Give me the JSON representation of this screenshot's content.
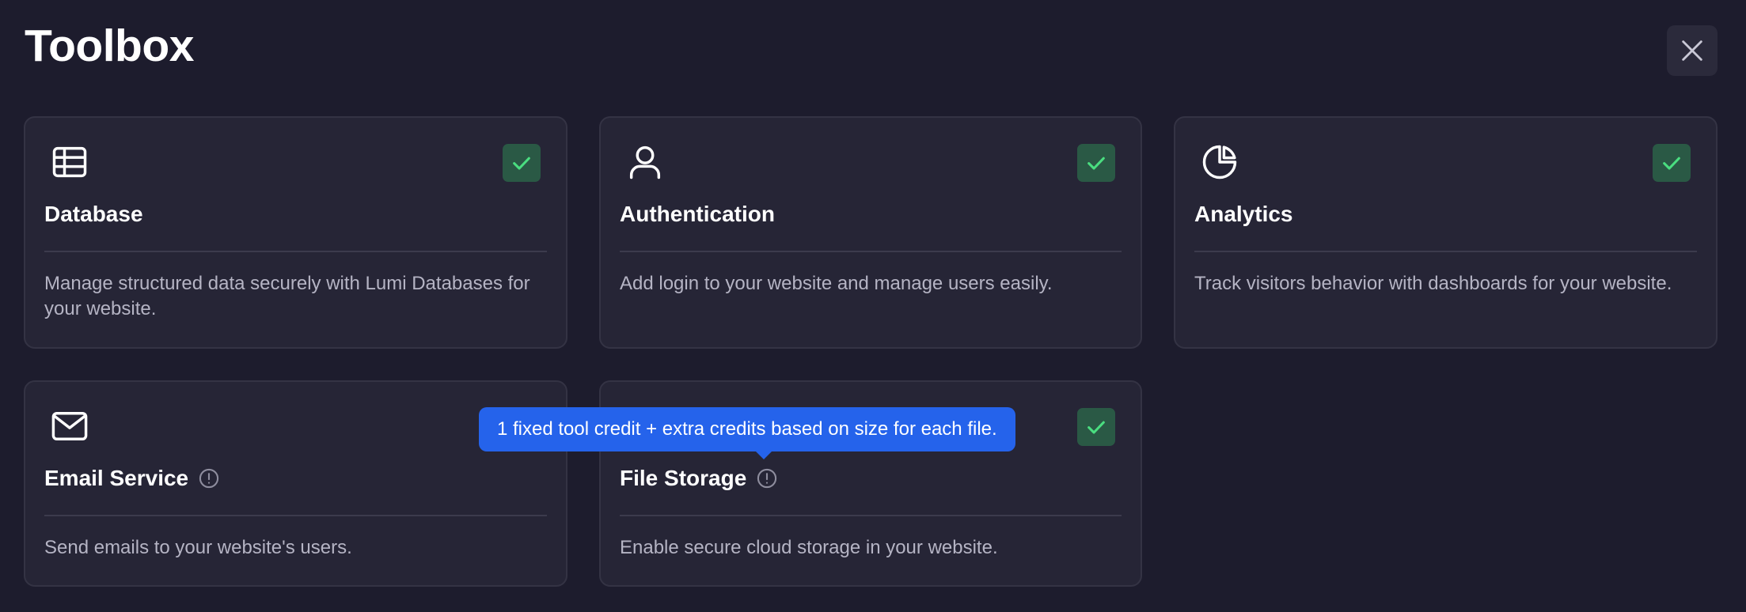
{
  "header": {
    "title": "Toolbox",
    "close_icon": "close-icon"
  },
  "cards": [
    {
      "name": "Database",
      "icon": "table-icon",
      "enabled": true,
      "has_info": false,
      "description": "Manage structured data securely with Lumi Databases for your website."
    },
    {
      "name": "Authentication",
      "icon": "user-icon",
      "enabled": true,
      "has_info": false,
      "description": "Add login to your website and manage users easily."
    },
    {
      "name": "Analytics",
      "icon": "pie-chart-icon",
      "enabled": true,
      "has_info": false,
      "description": "Track visitors behavior with dashboards for your website."
    },
    {
      "name": "Email Service",
      "icon": "mail-icon",
      "enabled": false,
      "has_info": true,
      "description": "Send emails to your website's users."
    },
    {
      "name": "File Storage",
      "icon": "cloud-storage-icon",
      "enabled": true,
      "has_info": true,
      "description": "Enable secure cloud storage in your website."
    }
  ],
  "tooltip": {
    "text": "1 fixed tool credit + extra credits based on size for each file."
  },
  "colors": {
    "background": "#1d1c2d",
    "card": "#262536",
    "check_bg": "#2a5945",
    "check_mark": "#4ade80",
    "tooltip": "#2563eb"
  }
}
